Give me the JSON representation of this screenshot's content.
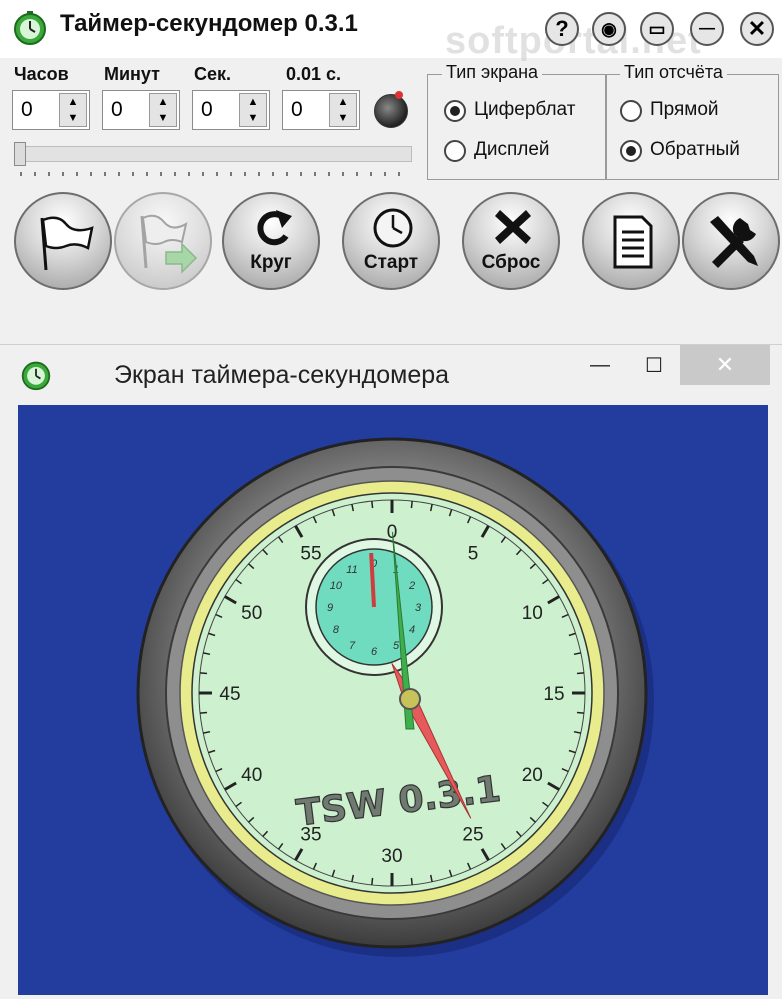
{
  "app": {
    "title": "Таймер-секундомер 0.3.1",
    "watermark": "softportal.net",
    "header_buttons": [
      {
        "name": "help",
        "glyph": "?"
      },
      {
        "name": "view",
        "glyph": "◉"
      },
      {
        "name": "compact",
        "glyph": "▭"
      },
      {
        "name": "minimize",
        "glyph": "—"
      },
      {
        "name": "close",
        "glyph": "✕"
      }
    ]
  },
  "fields": [
    {
      "label": "Часов",
      "value": "0"
    },
    {
      "label": "Минут",
      "value": "0"
    },
    {
      "label": "Сек.",
      "value": "0"
    },
    {
      "label": "0.01 с.",
      "value": "0"
    }
  ],
  "slider": {
    "value": 0
  },
  "screen_type": {
    "title": "Тип экрана",
    "options": [
      {
        "label": "Циферблат",
        "selected": true
      },
      {
        "label": "Дисплей",
        "selected": false
      }
    ]
  },
  "count_type": {
    "title": "Тип отсчёта",
    "options": [
      {
        "label": "Прямой",
        "selected": false
      },
      {
        "label": "Обратный",
        "selected": true
      }
    ]
  },
  "buttons": [
    {
      "name": "finish-flag",
      "label": "",
      "icon": "flag-icon",
      "enabled": true
    },
    {
      "name": "export",
      "label": "",
      "icon": "flag-arrow-icon",
      "enabled": false
    },
    {
      "name": "lap",
      "label": "Круг",
      "icon": "refresh-icon",
      "enabled": true
    },
    {
      "name": "start",
      "label": "Старт",
      "icon": "clock-icon",
      "enabled": true
    },
    {
      "name": "reset",
      "label": "Сброс",
      "icon": "cross-icon",
      "enabled": true
    },
    {
      "name": "log",
      "label": "",
      "icon": "document-icon",
      "enabled": true
    },
    {
      "name": "settings",
      "label": "",
      "icon": "tools-icon",
      "enabled": true
    }
  ],
  "screen_window": {
    "title": "Экран таймера-секундомера",
    "minimize": "—",
    "maximize": "☐",
    "close": "✕",
    "bg_color": "#223d9e"
  },
  "dial": {
    "brand": "TSW 0.3.1",
    "numbers": [
      "0",
      "5",
      "10",
      "15",
      "20",
      "25",
      "30",
      "35",
      "40",
      "45",
      "50",
      "55"
    ],
    "sub_numbers": [
      "0",
      "1",
      "2",
      "3",
      "4",
      "5",
      "6",
      "7",
      "8",
      "9",
      "10",
      "11"
    ],
    "hand_seconds": 25.5,
    "hand_minutes": 59.5,
    "face_color": "#cdf0cf",
    "ring_color": "#e8ec8c",
    "sub_color": "#6fdcc0"
  }
}
